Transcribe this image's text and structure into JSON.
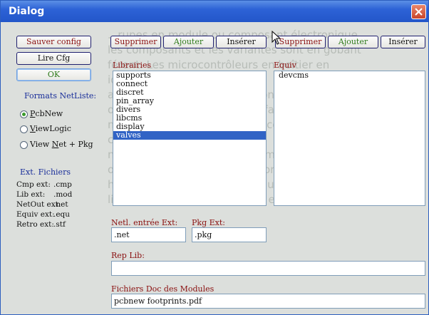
{
  "window": {
    "title": "Dialog"
  },
  "left": {
    "save_config": "Sauver config",
    "read_cfg": "Lire Cfg",
    "ok": "OK",
    "formats_label": "Formats NetListe:",
    "formats": [
      {
        "label": "PcbNew",
        "underline": "P",
        "rest": "cbNew",
        "selected": true
      },
      {
        "label": "ViewLogic",
        "underline": "V",
        "rest": "iewLogic",
        "selected": false
      },
      {
        "pre": "View ",
        "underline": "N",
        "rest": "et + Pkg",
        "selected": false
      }
    ],
    "ext_label": "Ext. Fichiers",
    "extensions": [
      {
        "name": "Cmp ext:",
        "value": ".cmp"
      },
      {
        "name": "Lib ext:",
        "value": ".mod"
      },
      {
        "name": "NetOut ext:",
        "value": ".net"
      },
      {
        "name": "Equiv ext:",
        "value": ".equ"
      },
      {
        "name": "Retro ext:",
        "value": ".stf"
      }
    ]
  },
  "libraries": {
    "buttons": {
      "delete": "Supprimer",
      "add": "Ajouter",
      "insert": "Insérer"
    },
    "label": "Librairies",
    "items": [
      "supports",
      "connect",
      "discret",
      "pin_array",
      "divers",
      "libcms",
      "display",
      "valves"
    ],
    "selected_index": 7
  },
  "equiv": {
    "buttons": {
      "delete": "Supprimer",
      "add": "Ajouter",
      "insert": "Insérer"
    },
    "label": "Equiv",
    "items": [
      "devcms"
    ]
  },
  "fields": {
    "netl_label": "Netl. entrée Ext:",
    "netl_value": ".net",
    "pkg_label": "Pkg Ext:",
    "pkg_value": ".pkg",
    "replib_label": "Rep Lib:",
    "replib_value": "",
    "docs_label": "Fichiers Doc des Modules",
    "docs_value": "pcbnew footprints.pdf"
  },
  "background_text": [
    "...rupes en module ou composant électronique",
    "les composants et les variantes sont en gobant",
    "férent. Les microcontrôleurs en boîtier en",
    "ique.",
    "ans la suite Kicad, l'association entre composant",
    "on module correspondant se fait de façon interactive",
    "mode automatique ou non, à condition de disposer",
    "chiers d'équivalence.",
    "n a la possibilité de créer soi-même ses fichiers",
    "ont en réalité des tables de correspondances entre",
    "haque composant et son module.",
    "liste des modules disponibles en appel du logiciel de circuit"
  ]
}
